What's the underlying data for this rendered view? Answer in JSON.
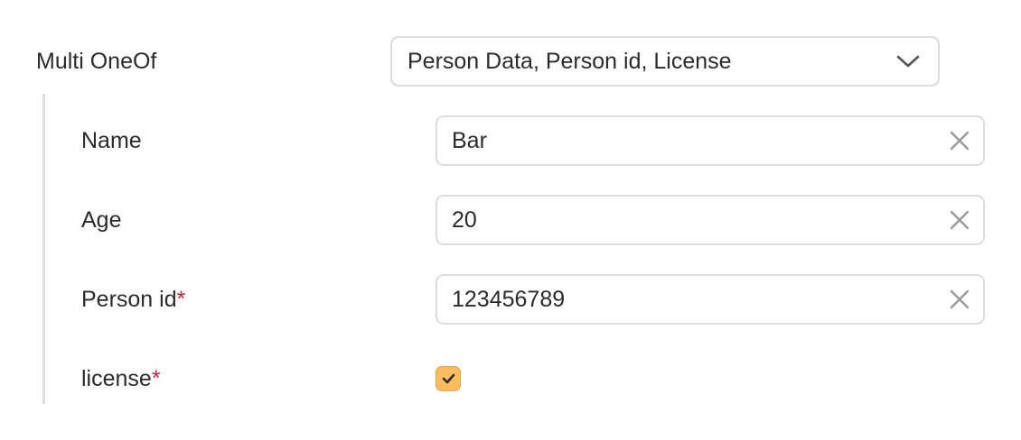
{
  "multi_oneof": {
    "label": "Multi OneOf",
    "selected_value": "Person Data, Person id, License"
  },
  "fields": [
    {
      "label": "Name",
      "value": "Bar",
      "required": ""
    },
    {
      "label": "Age",
      "value": "20",
      "required": ""
    },
    {
      "label": "Person id",
      "value": "123456789",
      "required": "*"
    },
    {
      "label": "license",
      "checked": true,
      "required": "*"
    }
  ],
  "icons": {
    "dropdown": "chevron-down-icon",
    "clear": "close-icon",
    "check": "check-icon"
  },
  "colors": {
    "checkbox_fill": "#fbbd5e",
    "required_marker": "#d4213d"
  }
}
